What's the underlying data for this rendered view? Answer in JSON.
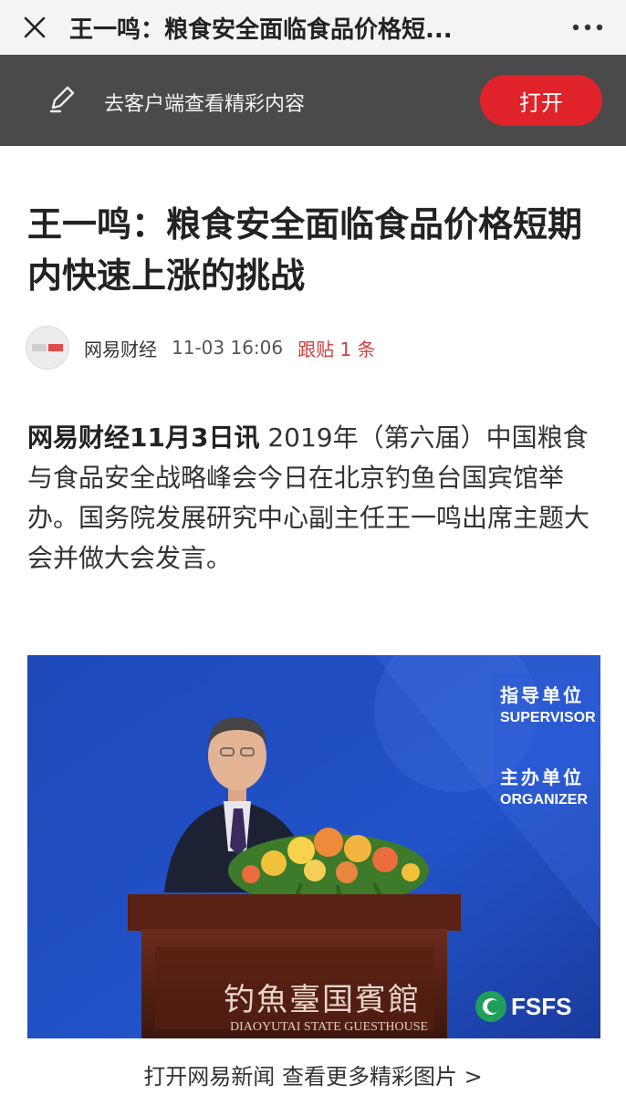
{
  "topbar": {
    "close_icon": "close-icon",
    "title": "王一鸣：粮食安全面临食品价格短...",
    "more_icon": "more-dots-icon"
  },
  "promo": {
    "icon": "pen-icon",
    "text": "去客户端查看精彩内容",
    "open_label": "打开"
  },
  "article": {
    "headline": "王一鸣：粮食安全面临食品价格短期内快速上涨的挑战",
    "source": "网易财经",
    "time": "11-03 16:06",
    "comments": "跟贴 1 条",
    "lead": "网易财经11月3日讯",
    "body": " 2019年（第六届）中国粮食与食品安全战略峰会今日在北京钓鱼台国宾馆举办。国务院发展研究中心副主任王一鸣出席主题大会并做大会发言。"
  },
  "photo": {
    "banner_line1_cn": "指导单位",
    "banner_line1_en": "SUPERVISOR",
    "banner_line2_cn": "主办单位",
    "banner_line2_en": "ORGANIZER",
    "podium_cn": "钓魚臺国賓館",
    "podium_en": "DIAOYUTAI STATE GUESTHOUSE",
    "logo": "FSFS"
  },
  "footer": {
    "link": "打开网易新闻 查看更多精彩图片 >"
  }
}
